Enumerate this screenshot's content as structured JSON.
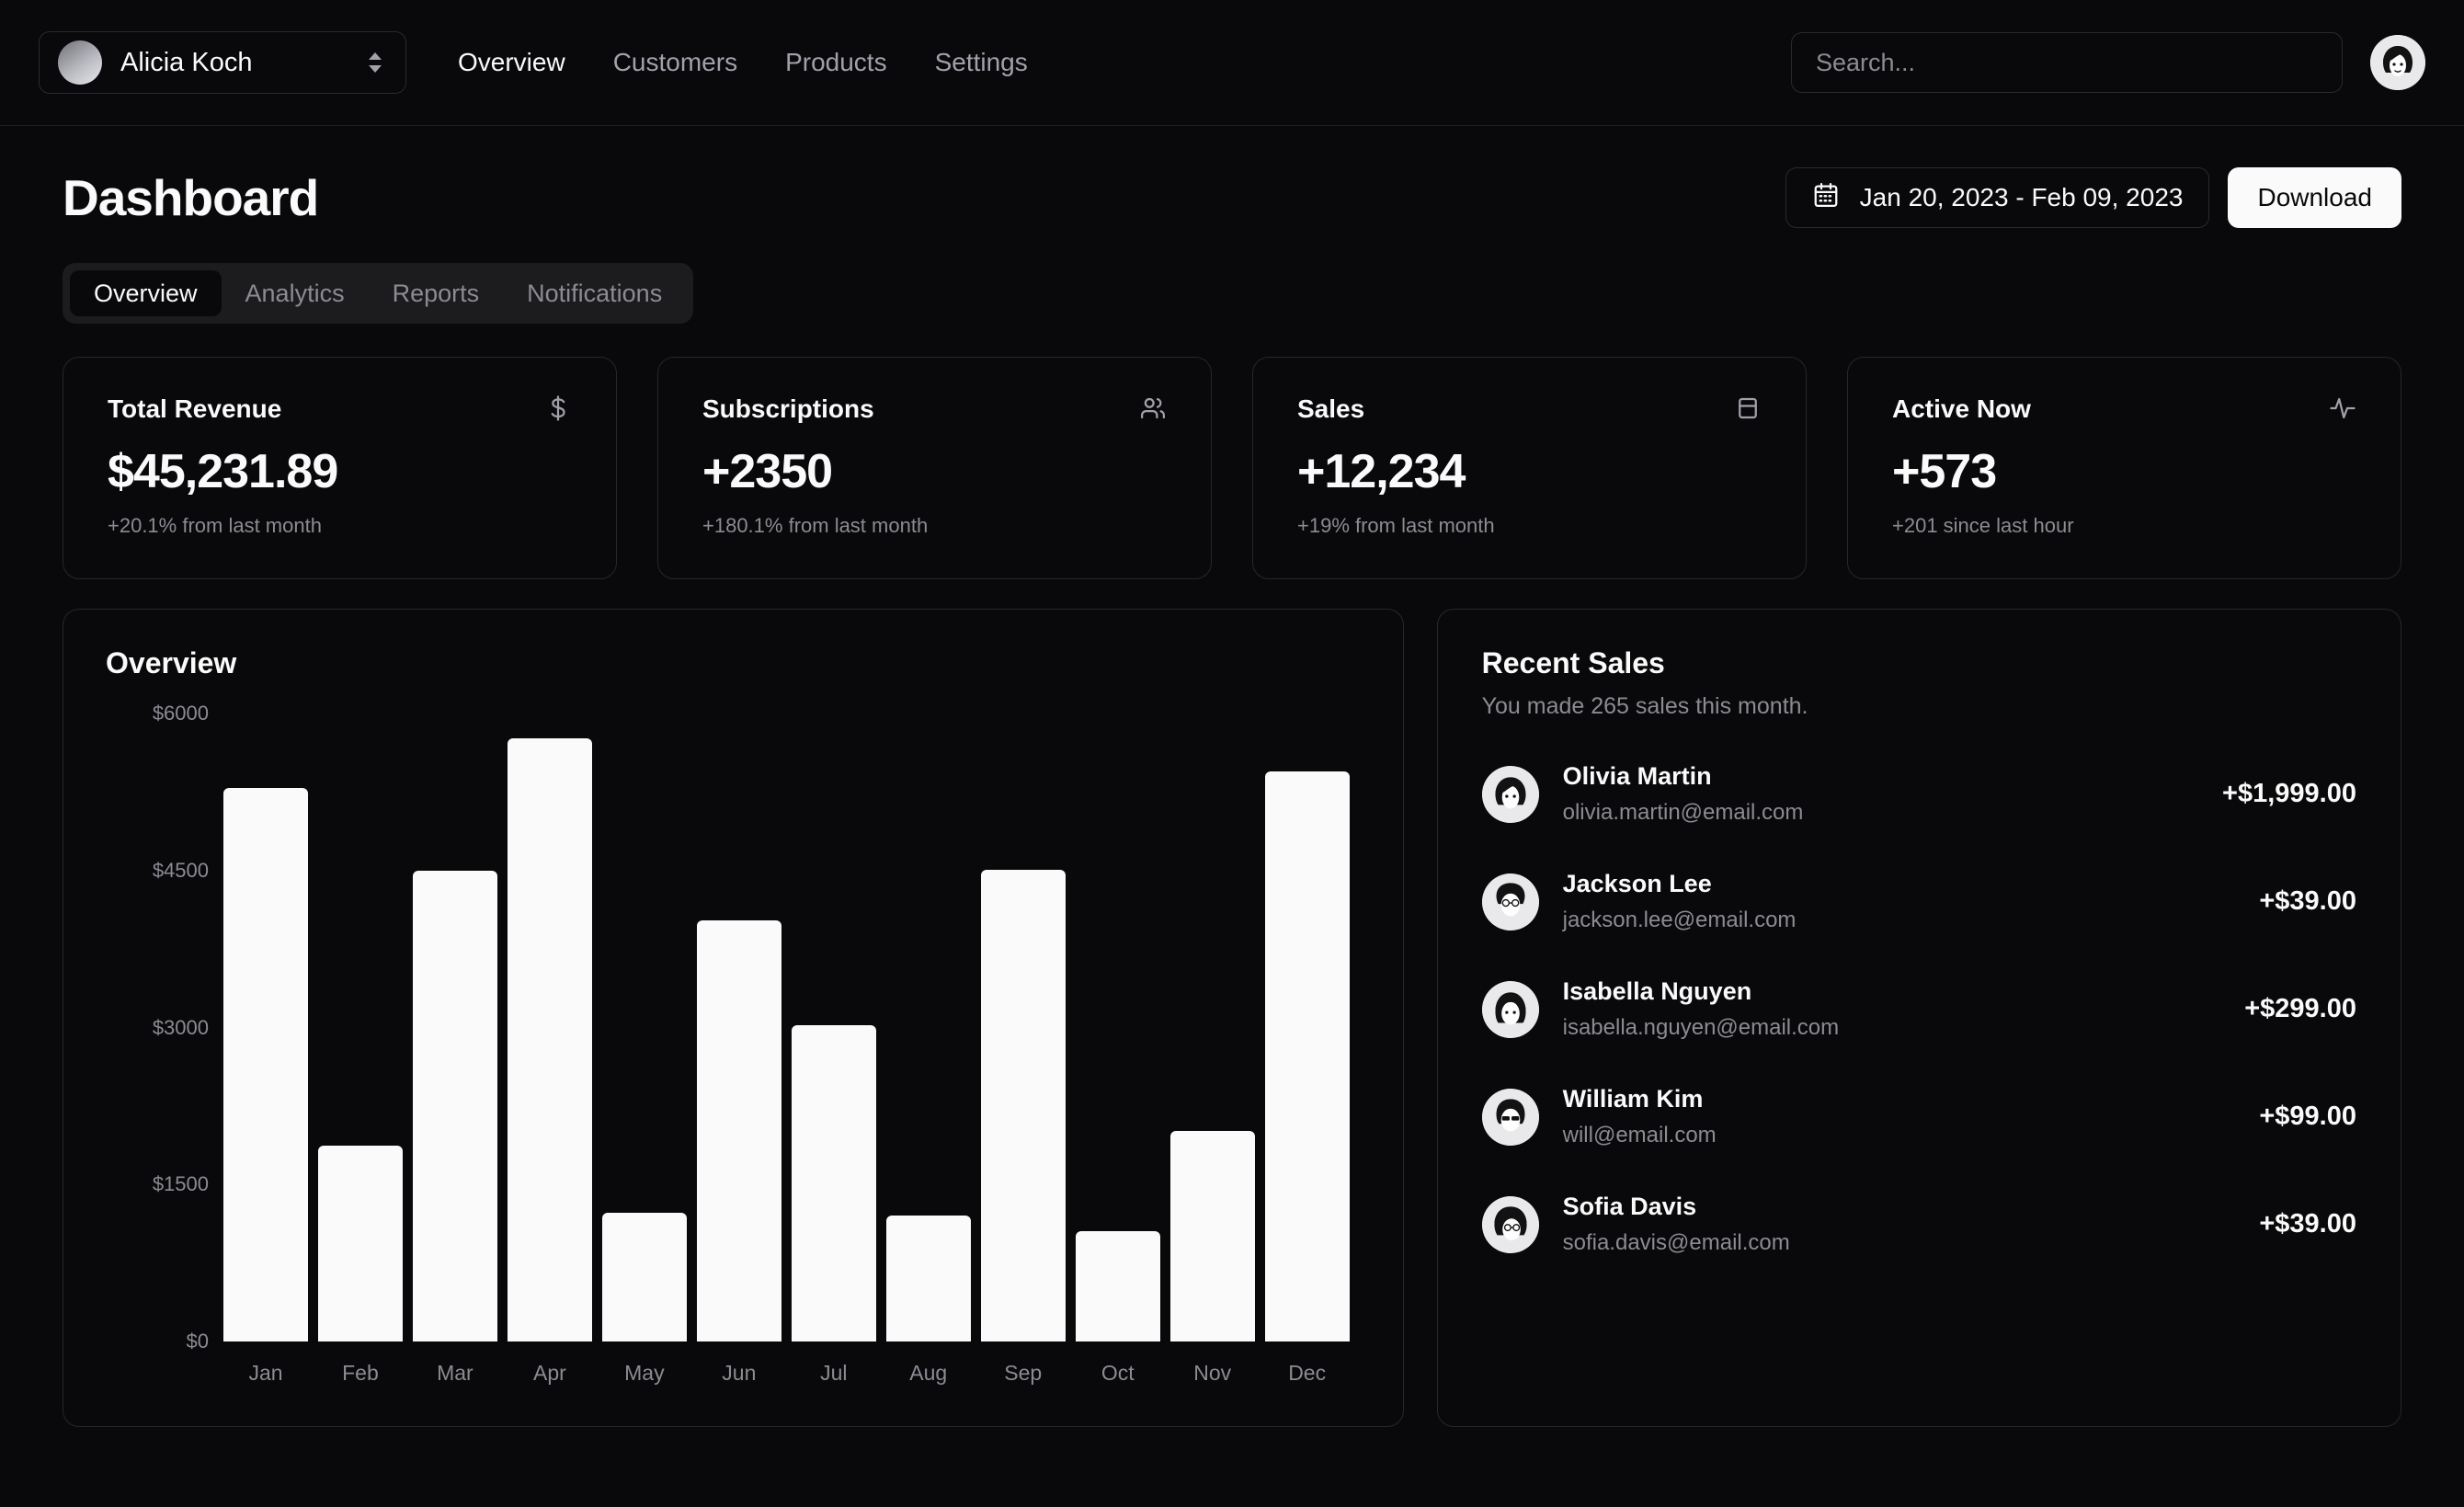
{
  "topbar": {
    "team": {
      "name": "Alicia Koch"
    },
    "nav": [
      {
        "label": "Overview",
        "active": true
      },
      {
        "label": "Customers",
        "active": false
      },
      {
        "label": "Products",
        "active": false
      },
      {
        "label": "Settings",
        "active": false
      }
    ],
    "search": {
      "placeholder": "Search...",
      "value": ""
    }
  },
  "page": {
    "title": "Dashboard",
    "date_range": "Jan 20, 2023 - Feb 09, 2023",
    "download_label": "Download"
  },
  "tabs": [
    {
      "label": "Overview",
      "active": true
    },
    {
      "label": "Analytics",
      "active": false
    },
    {
      "label": "Reports",
      "active": false
    },
    {
      "label": "Notifications",
      "active": false
    }
  ],
  "stats": [
    {
      "label": "Total Revenue",
      "value": "$45,231.89",
      "sub": "+20.1% from last month",
      "icon": "dollar-sign-icon"
    },
    {
      "label": "Subscriptions",
      "value": "+2350",
      "sub": "+180.1% from last month",
      "icon": "users-icon"
    },
    {
      "label": "Sales",
      "value": "+12,234",
      "sub": "+19% from last month",
      "icon": "credit-card-icon"
    },
    {
      "label": "Active Now",
      "value": "+573",
      "sub": "+201 since last hour",
      "icon": "activity-icon"
    }
  ],
  "overview": {
    "title": "Overview"
  },
  "recent_sales": {
    "title": "Recent Sales",
    "subtitle": "You made 265 sales this month.",
    "rows": [
      {
        "name": "Olivia Martin",
        "email": "olivia.martin@email.com",
        "amount": "+$1,999.00"
      },
      {
        "name": "Jackson Lee",
        "email": "jackson.lee@email.com",
        "amount": "+$39.00"
      },
      {
        "name": "Isabella Nguyen",
        "email": "isabella.nguyen@email.com",
        "amount": "+$299.00"
      },
      {
        "name": "William Kim",
        "email": "will@email.com",
        "amount": "+$99.00"
      },
      {
        "name": "Sofia Davis",
        "email": "sofia.davis@email.com",
        "amount": "+$39.00"
      }
    ]
  },
  "chart_data": {
    "type": "bar",
    "title": "Overview",
    "xlabel": "",
    "ylabel": "",
    "categories": [
      "Jan",
      "Feb",
      "Mar",
      "Apr",
      "May",
      "Jun",
      "Jul",
      "Aug",
      "Sep",
      "Oct",
      "Nov",
      "Dec"
    ],
    "values": [
      5290,
      1870,
      4500,
      5760,
      1230,
      4020,
      3020,
      1200,
      4510,
      1050,
      2010,
      5450
    ],
    "ylim": [
      0,
      6000
    ],
    "yticks": [
      0,
      1500,
      3000,
      4500,
      6000
    ],
    "ytick_labels": [
      "$0",
      "$1500",
      "$3000",
      "$4500",
      "$6000"
    ],
    "grid": false,
    "legend": false,
    "bar_color": "#fafafa"
  },
  "theme": {
    "background": "#09090b",
    "foreground": "#fafafa",
    "muted": "#8b8b93",
    "border": "#27272a",
    "accent": "#1c1c1f"
  }
}
